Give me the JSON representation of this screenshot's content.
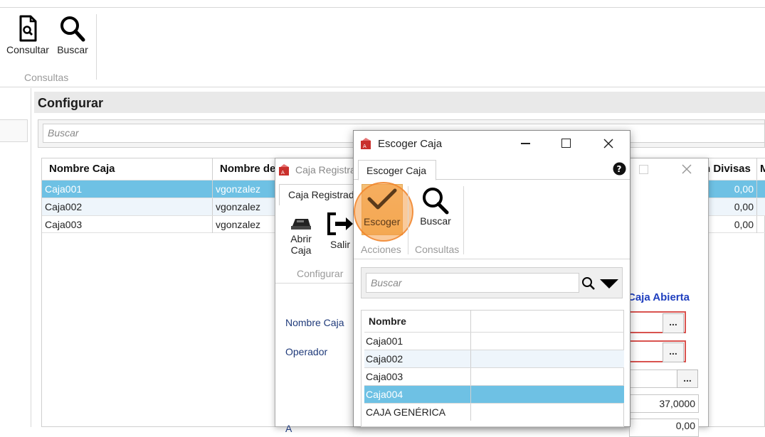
{
  "ribbon": {
    "buttons": [
      {
        "label": "Consultar",
        "icon": "document-search-icon"
      },
      {
        "label": "Buscar",
        "icon": "magnifier-icon"
      }
    ],
    "group_label": "Consultas"
  },
  "configurar": {
    "title": "Configurar",
    "search_placeholder": "Buscar",
    "columns": [
      "Nombre Caja",
      "Nombre de",
      "n Divisas",
      "M"
    ],
    "rows": [
      {
        "caja": "Caja001",
        "operador": "vgonzalez",
        "divisas": "0,00"
      },
      {
        "caja": "Caja002",
        "operador": "vgonzalez",
        "divisas": "0,00"
      },
      {
        "caja": "Caja003",
        "operador": "vgonzalez",
        "divisas": "0,00"
      }
    ]
  },
  "caja_registradora": {
    "title": "Caja Registra",
    "tab": "Caja Registrad",
    "buttons": [
      {
        "label": "Abrir\nCaja",
        "icon": "cash-register-icon"
      },
      {
        "label": "Salir",
        "icon": "exit-icon"
      }
    ],
    "group_label": "Configurar",
    "status": "Caja Abierta",
    "fields": {
      "nombre_caja_label": "Nombre Caja",
      "operador_label": "Operador",
      "rate_value": "37,0000",
      "bottom_value": "0,00",
      "bottom_label": "A"
    }
  },
  "escoger_caja": {
    "title": "Escoger Caja",
    "tab": "Escoger Caja",
    "buttons": [
      {
        "label": "Escoger",
        "icon": "checkmark-icon"
      },
      {
        "label": "Buscar",
        "icon": "magnifier-icon"
      }
    ],
    "groups": [
      "Acciones",
      "Consultas"
    ],
    "search_placeholder": "Buscar",
    "column": "Nombre",
    "rows": [
      "Caja001",
      "Caja002",
      "Caja003",
      "Caja004",
      "CAJA GENÉRICA"
    ],
    "selected_index": 3
  },
  "colors": {
    "selection": "#6ec1e4",
    "accent_orange": "#f29a45",
    "status_blue": "#1f3fbf",
    "error_red": "#d9534f"
  }
}
